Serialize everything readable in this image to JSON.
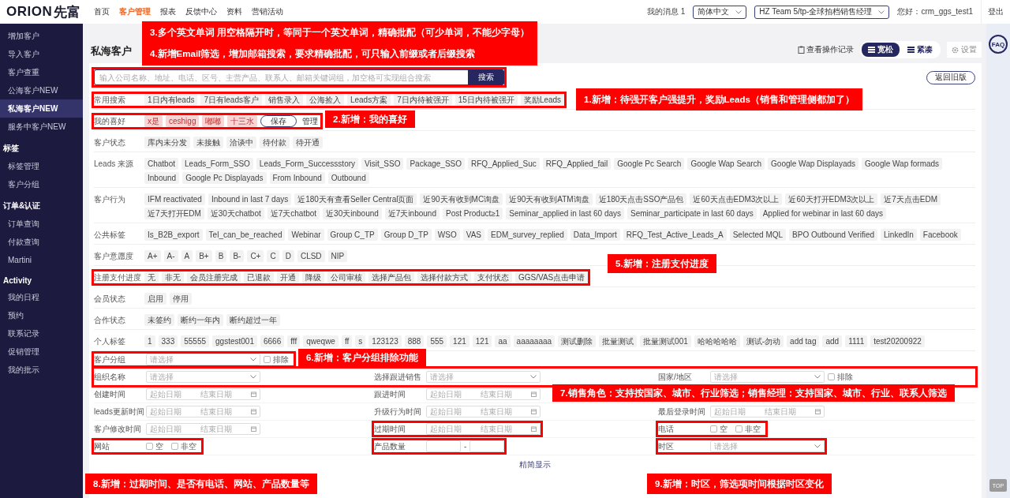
{
  "topbar": {
    "logo": "ORION",
    "logo_cn": "先富",
    "nav": [
      {
        "label": "首页",
        "selected": false
      },
      {
        "label": "客户管理",
        "selected": true
      },
      {
        "label": "报表",
        "selected": false
      },
      {
        "label": "反馈中心",
        "selected": false
      },
      {
        "label": "资料",
        "selected": false
      },
      {
        "label": "营销活动",
        "selected": false
      }
    ],
    "messages": "我的消息 1",
    "language": "简体中文",
    "role": "HZ Team 5/tp-全球拍档销售经理",
    "greeting": "您好：crm_ggs_test1",
    "logout": "登出"
  },
  "sidebar": [
    {
      "items": [
        {
          "label": "增加客户",
          "selected": false
        },
        {
          "label": "导入客户",
          "selected": false
        },
        {
          "label": "客户查重",
          "selected": false
        },
        {
          "label": "公海客户NEW",
          "selected": false
        },
        {
          "label": "私海客户NEW",
          "selected": true
        },
        {
          "label": "服务中客户NEW",
          "selected": false
        }
      ]
    },
    {
      "title": "标签",
      "items": [
        {
          "label": "标签管理",
          "selected": false
        },
        {
          "label": "客户分组",
          "selected": false
        }
      ]
    },
    {
      "title": "订单&认证",
      "items": [
        {
          "label": "订单查询",
          "selected": false
        },
        {
          "label": "付款查询",
          "selected": false
        },
        {
          "label": "Martini",
          "selected": false
        }
      ]
    },
    {
      "title": "Activity",
      "items": [
        {
          "label": "我的日程",
          "selected": false
        },
        {
          "label": "预约",
          "selected": false
        },
        {
          "label": "联系记录",
          "selected": false
        },
        {
          "label": "促销管理",
          "selected": false
        },
        {
          "label": "我的批示",
          "selected": false
        }
      ]
    }
  ],
  "page": {
    "title": "私海客户",
    "history": "查看操作记录",
    "density": [
      {
        "label": "宽松",
        "selected": true
      },
      {
        "label": "紧凑",
        "selected": false
      }
    ],
    "settings": "设置",
    "back": "返回旧版"
  },
  "search": {
    "placeholder": "输入公司名称、地址、电话、区号、主营产品、联系人、邮箱关键词组，加空格可实现组合搜索",
    "button": "搜索",
    "marked": true
  },
  "filters": [
    {
      "label": "常用搜索",
      "marked": true,
      "tags": [
        {
          "text": "1日内有leads",
          "kind": "plain"
        },
        {
          "text": "7日有leads客户",
          "kind": "plain"
        },
        {
          "text": "销售录入",
          "kind": "plain"
        },
        {
          "text": "公海捡入",
          "kind": "plain"
        },
        {
          "text": "Leads方案",
          "kind": "plain"
        },
        {
          "text": "7日内待被强开",
          "kind": "plain"
        },
        {
          "text": "15日内待被强开",
          "kind": "plain"
        },
        {
          "text": "奖励Leads",
          "kind": "plain"
        }
      ]
    },
    {
      "label": "我的喜好",
      "marked": true,
      "tags": [
        {
          "text": "x是",
          "kind": "favorite"
        },
        {
          "text": "ceshigg",
          "kind": "favorite"
        },
        {
          "text": "嘟嘟",
          "kind": "favorite"
        },
        {
          "text": "十三水",
          "kind": "favorite"
        }
      ],
      "actions": [
        {
          "label": "保存",
          "kind": "button"
        },
        {
          "label": "管理",
          "kind": "link"
        }
      ]
    },
    {
      "label": "客户状态",
      "marked": false,
      "tags": [
        {
          "text": "库内未分发",
          "kind": "plain"
        },
        {
          "text": "未接触",
          "kind": "plain"
        },
        {
          "text": "洽谈中",
          "kind": "plain"
        },
        {
          "text": "待付款",
          "kind": "plain"
        },
        {
          "text": "待开通",
          "kind": "plain"
        }
      ]
    },
    {
      "label": "Leads 来源",
      "marked": false,
      "tags": [
        {
          "text": "Chatbot",
          "kind": "plain"
        },
        {
          "text": "Leads_Form_SSO",
          "kind": "plain"
        },
        {
          "text": "Leads_Form_Successstory",
          "kind": "plain"
        },
        {
          "text": "Visit_SSO",
          "kind": "plain"
        },
        {
          "text": "Package_SSO",
          "kind": "plain"
        },
        {
          "text": "RFQ_Applied_Suc",
          "kind": "plain"
        },
        {
          "text": "RFQ_Applied_fail",
          "kind": "plain"
        },
        {
          "text": "Google Pc Search",
          "kind": "plain"
        },
        {
          "text": "Google Wap Search",
          "kind": "plain"
        },
        {
          "text": "Google Wap Displayads",
          "kind": "plain"
        },
        {
          "text": "Google Wap formads",
          "kind": "plain"
        },
        {
          "text": "Inbound",
          "kind": "plain"
        },
        {
          "text": "Google Pc Displayads",
          "kind": "plain"
        },
        {
          "text": "From Inbound",
          "kind": "plain"
        },
        {
          "text": "Outbound",
          "kind": "plain"
        }
      ]
    },
    {
      "label": "客户行为",
      "marked": false,
      "tags": [
        {
          "text": "IFM reactivated",
          "kind": "plain"
        },
        {
          "text": "Inbound in last 7 days",
          "kind": "plain"
        },
        {
          "text": "近180天有查看Seller Central页面",
          "kind": "plain"
        },
        {
          "text": "近90天有收到MC询盘",
          "kind": "plain"
        },
        {
          "text": "近90天有收到ATM询盘",
          "kind": "plain"
        },
        {
          "text": "近180天点击SSO产品包",
          "kind": "plain"
        },
        {
          "text": "近60天点击EDM3次以上",
          "kind": "plain"
        },
        {
          "text": "近60天打开EDM3次以上",
          "kind": "plain"
        },
        {
          "text": "近7天点击EDM",
          "kind": "plain"
        },
        {
          "text": "近7天打开EDM",
          "kind": "plain"
        },
        {
          "text": "近30天chatbot",
          "kind": "plain"
        },
        {
          "text": "近7天chatbot",
          "kind": "plain"
        },
        {
          "text": "近30天inbound",
          "kind": "plain"
        },
        {
          "text": "近7天inbound",
          "kind": "plain"
        },
        {
          "text": "Post Product≥1",
          "kind": "plain"
        },
        {
          "text": "Seminar_applied in last 60 days",
          "kind": "plain"
        },
        {
          "text": "Seminar_participate in last 60 days",
          "kind": "plain"
        },
        {
          "text": "Applied for webinar in last 60 days",
          "kind": "plain"
        }
      ]
    },
    {
      "label": "公共标签",
      "marked": false,
      "tags": [
        {
          "text": "Is_B2B_export",
          "kind": "plain"
        },
        {
          "text": "Tel_can_be_reached",
          "kind": "plain"
        },
        {
          "text": "Webinar",
          "kind": "plain"
        },
        {
          "text": "Group C_TP",
          "kind": "plain"
        },
        {
          "text": "Group D_TP",
          "kind": "plain"
        },
        {
          "text": "WSO",
          "kind": "plain"
        },
        {
          "text": "VAS",
          "kind": "plain"
        },
        {
          "text": "EDM_survey_replied",
          "kind": "plain"
        },
        {
          "text": "Data_Import",
          "kind": "plain"
        },
        {
          "text": "RFQ_Test_Active_Leads_A",
          "kind": "plain"
        },
        {
          "text": "Selected MQL",
          "kind": "plain"
        },
        {
          "text": "BPO Outbound Verified",
          "kind": "plain"
        },
        {
          "text": "LinkedIn",
          "kind": "plain"
        },
        {
          "text": "Facebook",
          "kind": "plain"
        }
      ]
    },
    {
      "label": "客户意愿度",
      "marked": false,
      "tags": [
        {
          "text": "A+",
          "kind": "plain"
        },
        {
          "text": "A-",
          "kind": "plain"
        },
        {
          "text": "A",
          "kind": "plain"
        },
        {
          "text": "B+",
          "kind": "plain"
        },
        {
          "text": "B",
          "kind": "plain"
        },
        {
          "text": "B-",
          "kind": "plain"
        },
        {
          "text": "C+",
          "kind": "plain"
        },
        {
          "text": "C",
          "kind": "plain"
        },
        {
          "text": "D",
          "kind": "plain"
        },
        {
          "text": "CLSD",
          "kind": "plain"
        },
        {
          "text": "NIP",
          "kind": "plain"
        }
      ]
    },
    {
      "label": "注册支付进度",
      "marked": true,
      "tags": [
        {
          "text": "无",
          "kind": "plain"
        },
        {
          "text": "非无",
          "kind": "plain"
        },
        {
          "text": "会员注册完成",
          "kind": "plain"
        },
        {
          "text": "已退款",
          "kind": "plain"
        },
        {
          "text": "开通",
          "kind": "plain"
        },
        {
          "text": "降级",
          "kind": "plain"
        },
        {
          "text": "公司审核",
          "kind": "plain"
        },
        {
          "text": "选择产品包",
          "kind": "plain"
        },
        {
          "text": "选择付款方式",
          "kind": "plain"
        },
        {
          "text": "支付状态",
          "kind": "plain"
        },
        {
          "text": "GGS/VAS点击申请",
          "kind": "plain"
        }
      ]
    },
    {
      "label": "会员状态",
      "marked": false,
      "tags": [
        {
          "text": "启用",
          "kind": "plain"
        },
        {
          "text": "停用",
          "kind": "plain"
        }
      ]
    },
    {
      "label": "合作状态",
      "marked": false,
      "tags": [
        {
          "text": "未签约",
          "kind": "plain"
        },
        {
          "text": "断约一年内",
          "kind": "plain"
        },
        {
          "text": "断约超过一年",
          "kind": "plain"
        }
      ]
    },
    {
      "label": "个人标签",
      "marked": false,
      "tags": [
        {
          "text": "1",
          "kind": "plain"
        },
        {
          "text": "333",
          "kind": "plain"
        },
        {
          "text": "55555",
          "kind": "plain"
        },
        {
          "text": "ggstest001",
          "kind": "plain"
        },
        {
          "text": "6666",
          "kind": "plain"
        },
        {
          "text": "fff",
          "kind": "plain"
        },
        {
          "text": "qweqwe",
          "kind": "plain"
        },
        {
          "text": "ff",
          "kind": "plain"
        },
        {
          "text": "s",
          "kind": "plain"
        },
        {
          "text": "123123",
          "kind": "plain"
        },
        {
          "text": "888",
          "kind": "plain"
        },
        {
          "text": "555",
          "kind": "plain"
        },
        {
          "text": "121",
          "kind": "plain"
        },
        {
          "text": "121",
          "kind": "plain"
        },
        {
          "text": "aa",
          "kind": "plain"
        },
        {
          "text": "aaaaaaaa",
          "kind": "plain"
        },
        {
          "text": "测试删除",
          "kind": "plain"
        },
        {
          "text": "批量测试",
          "kind": "plain"
        },
        {
          "text": "批量测试001",
          "kind": "plain"
        },
        {
          "text": "哈哈哈哈哈",
          "kind": "plain"
        },
        {
          "text": "测试-勿动",
          "kind": "plain"
        },
        {
          "text": "add tag",
          "kind": "plain"
        },
        {
          "text": "add",
          "kind": "plain"
        },
        {
          "text": "1111",
          "kind": "plain"
        },
        {
          "text": "test20200922",
          "kind": "plain"
        }
      ]
    }
  ],
  "form": [
    {
      "marked": false,
      "items": [
        {
          "label": "客户分组",
          "kind": "select",
          "placeholder": "请选择",
          "exclude": {
            "label": "排除",
            "checked": false
          },
          "marked": true
        }
      ]
    },
    {
      "marked": true,
      "items": [
        {
          "label": "组织名称",
          "kind": "select",
          "placeholder": "请选择",
          "marked": false
        },
        {
          "label": "选择跟进销售",
          "kind": "select",
          "placeholder": "请选择",
          "marked": false
        },
        {
          "label": "国家/地区",
          "kind": "select",
          "placeholder": "请选择",
          "exclude": {
            "label": "排除",
            "checked": false
          },
          "marked": false
        }
      ]
    },
    {
      "marked": false,
      "items": [
        {
          "label": "创建时间",
          "kind": "dates",
          "start": "起始日期",
          "end": "结束日期",
          "marked": false
        },
        {
          "label": "跟进时间",
          "kind": "dates",
          "start": "起始日期",
          "end": "结束日期",
          "marked": false
        }
      ]
    },
    {
      "marked": false,
      "items": [
        {
          "label": "leads更新时间",
          "kind": "dates",
          "start": "起始日期",
          "end": "结束日期",
          "marked": false
        },
        {
          "label": "升级行为时间",
          "kind": "dates",
          "start": "起始日期",
          "end": "结束日期",
          "marked": false
        },
        {
          "label": "最后登录时间",
          "kind": "dates",
          "start": "起始日期",
          "end": "结束日期",
          "marked": false
        }
      ]
    },
    {
      "marked": false,
      "items": [
        {
          "label": "客户修改时间",
          "kind": "dates",
          "start": "起始日期",
          "end": "结束日期",
          "marked": false
        },
        {
          "label": "过期时间",
          "kind": "dates",
          "start": "起始日期",
          "end": "结束日期",
          "marked": true
        },
        {
          "label": "电话",
          "kind": "checks",
          "options": [
            {
              "label": "空",
              "checked": false
            },
            {
              "label": "非空",
              "checked": false
            }
          ],
          "marked": true
        }
      ]
    },
    {
      "marked": false,
      "items": [
        {
          "label": "网站",
          "kind": "checks",
          "options": [
            {
              "label": "空",
              "checked": false
            },
            {
              "label": "非空",
              "checked": false
            }
          ],
          "marked": true
        },
        {
          "label": "产品数量",
          "kind": "range",
          "separator": "-",
          "marked": true
        },
        {
          "label": "时区",
          "kind": "select",
          "placeholder": "请选择",
          "marked": true
        }
      ]
    }
  ],
  "footer": {
    "toggle": "精简显示",
    "top": "TOP",
    "faq": "FAQ"
  },
  "annotations": [
    {
      "lines": [
        "3.多个英文单词 用空格隔开时，等同于一个英文单词，精确批配（可少单词，不能少字母）",
        "4.新增Email筛选，增加邮箱搜索，要求精确批配，可只输入前缀或者后缀搜索"
      ]
    },
    {
      "lines": [
        "1.新增：待强开客户强提升，奖励Leads（销售和管理侧都加了）"
      ]
    },
    {
      "lines": [
        "2.新增：我的喜好"
      ]
    },
    {
      "lines": [
        "5.新增：注册支付进度"
      ]
    },
    {
      "lines": [
        "6.新增：客户分组排除功能"
      ]
    },
    {
      "lines": [
        "7.销售角色：支持按国家、城市、行业筛选；销售经理：支持国家、城市、行业、联系人筛选"
      ]
    },
    {
      "lines": [
        "8.新增：过期时间、是否有电话、网站、产品数量等"
      ]
    },
    {
      "lines": [
        "9.新增：时区，筛选项时间根据时区变化"
      ]
    }
  ]
}
